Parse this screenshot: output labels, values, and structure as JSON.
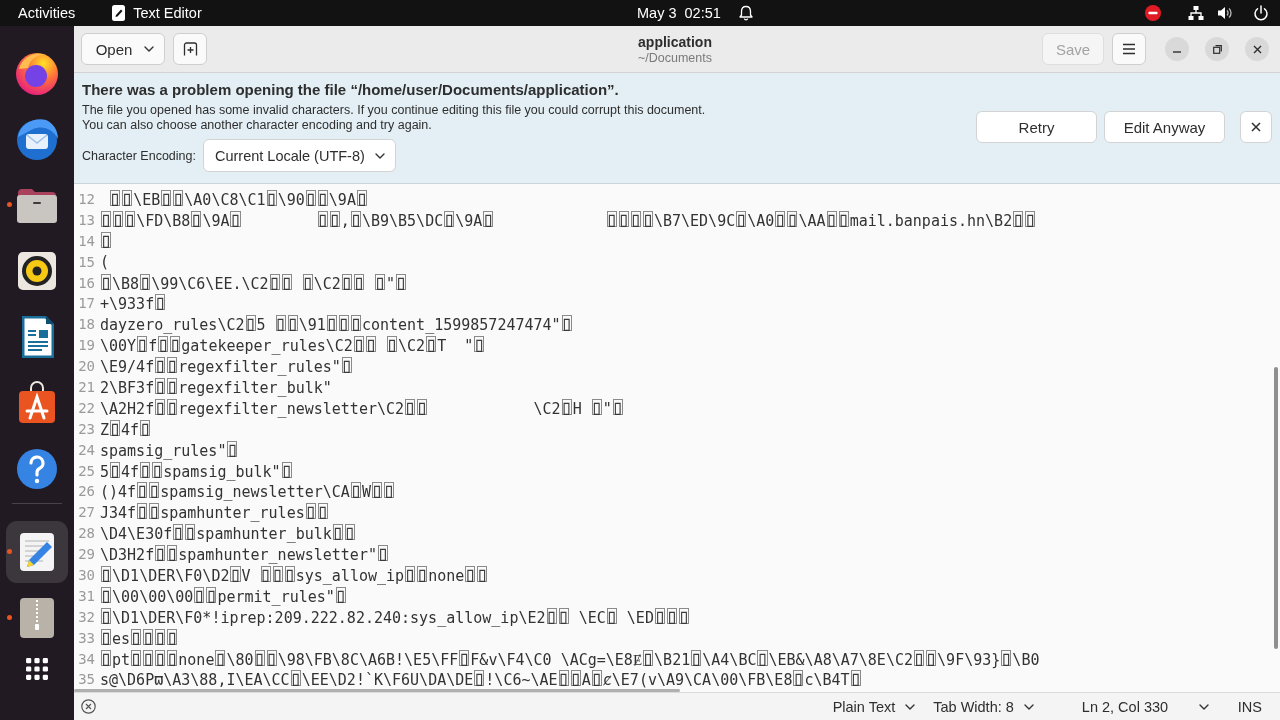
{
  "top_bar": {
    "activities": "Activities",
    "app_name": "Text Editor",
    "clock": "May 3  02:51"
  },
  "dock": {
    "pinned": [
      {
        "kind": "browser",
        "running": false,
        "selected": false
      },
      {
        "kind": "mail",
        "running": false,
        "selected": false
      },
      {
        "kind": "files",
        "running": true,
        "selected": false
      },
      {
        "kind": "music",
        "running": false,
        "selected": false
      },
      {
        "kind": "writer",
        "running": false,
        "selected": false
      },
      {
        "kind": "store",
        "running": false,
        "selected": false
      },
      {
        "kind": "help",
        "running": false,
        "selected": false
      }
    ],
    "open_apps": [
      {
        "kind": "editor",
        "running": true,
        "selected": true
      },
      {
        "kind": "archive",
        "running": true,
        "selected": false
      }
    ]
  },
  "header": {
    "open_button": "Open",
    "title": "application",
    "subtitle": "~/Documents",
    "save_button": {
      "label": "Save",
      "disabled": true
    }
  },
  "info_bar": {
    "title": "There was a problem opening the file “/home/user/Documents/application”.",
    "message": "The file you opened has some invalid characters. If you continue editing this file you could corrupt this document.\nYou can also choose another character encoding and try again.",
    "encoding_label": "Character Encoding:",
    "encoding_value": "Current Locale (UTF-8)",
    "buttons": [
      "Retry",
      "Edit Anyway"
    ]
  },
  "editor": {
    "lines": [
      {
        "number": "12",
        "text": " ▯▯\\EB▯▯\\A0\\C8\\C1▯\\90▯▯\\9A▯"
      },
      {
        "number": "13",
        "text": "▯▯▯\\FD\\B8▯\\9A▯\t▯▯,▯\\B9\\B5\\DC▯\\9A▯\t\t▯▯▯▯\\B7\\ED\\9C▯\\A0▯▯\\AA▯▯mail.banpais.hn\\B2▯▯"
      },
      {
        "number": "14",
        "text": "▯"
      },
      {
        "number": "15",
        "text": "("
      },
      {
        "number": "16",
        "text": "▯\\B8▯\\99\\C6\\EE.\\C2▯▯ ▯\\C2▯▯ ▯\"▯"
      },
      {
        "number": "17",
        "text": "+\\933f▯"
      },
      {
        "number": "18",
        "text": "dayzero_rules\\C2▯5 ▯▯\\91▯▯▯content_1599857247474\"▯"
      },
      {
        "number": "19",
        "text": "\\00Y▯f▯▯gatekeeper_rules\\C2▯▯ ▯\\C2▯T  \"▯"
      },
      {
        "number": "20",
        "text": "\\E9/4f▯▯regexfilter_rules\"▯"
      },
      {
        "number": "21",
        "text": "2\\BF3f▯▯regexfilter_bulk\""
      },
      {
        "number": "22",
        "text": "\\A2H2f▯▯regexfilter_newsletter\\C2▯▯\t\t\\C2▯H ▯\"▯"
      },
      {
        "number": "23",
        "text": "Z▯4f▯"
      },
      {
        "number": "24",
        "text": "spamsig_rules\"▯"
      },
      {
        "number": "25",
        "text": "5▯4f▯▯spamsig_bulk\"▯"
      },
      {
        "number": "26",
        "text": "()4f▯▯spamsig_newsletter\\CA▯W▯▯"
      },
      {
        "number": "27",
        "text": "J34f▯▯spamhunter_rules▯▯"
      },
      {
        "number": "28",
        "text": "\\D4\\E30f▯▯spamhunter_bulk▯▯"
      },
      {
        "number": "29",
        "text": "\\D3H2f▯▯spamhunter_newsletter\"▯"
      },
      {
        "number": "30",
        "text": "▯\\D1\\DER\\F0\\D2▯V ▯▯▯sys_allow_ip▯▯none▯▯"
      },
      {
        "number": "31",
        "text": "▯\\00\\00\\00▯▯permit_rules\"▯"
      },
      {
        "number": "32",
        "text": "▯\\D1\\DER\\F0*!iprep:209.222.82.240:sys_allow_ip\\E2▯▯ \\EC▯ \\ED▯▯▯"
      },
      {
        "number": "33",
        "text": "▯es▯▯▯▯"
      },
      {
        "number": "34",
        "text": "▯pt▯▯▯▯none▯\\80▯▯\\98\\FB\\8C\\A6B!\\E5\\FF▯F&v\\F4\\C0 \\ACg=\\E8Ɇ▯\\B21▯\\A4\\BC▯\\EB&\\A8\\A7\\8E\\C2▯▯\\9F\\93}▯\\B0"
      },
      {
        "number": "35",
        "text": "s@\\D6Pϖ\\A3\\88,I\\EA\\CC▯\\EE\\D2!`K\\F6U\\DA\\DE▯!\\C6~\\AE▯▯A▯ȼ\\E7(v\\A9\\CA\\00\\FB\\E8▯c\\B4T▯"
      }
    ]
  },
  "status_bar": {
    "language": "Plain Text",
    "tab_width": "Tab Width: 8",
    "position": "Ln 2, Col 330",
    "mode": "INS"
  }
}
